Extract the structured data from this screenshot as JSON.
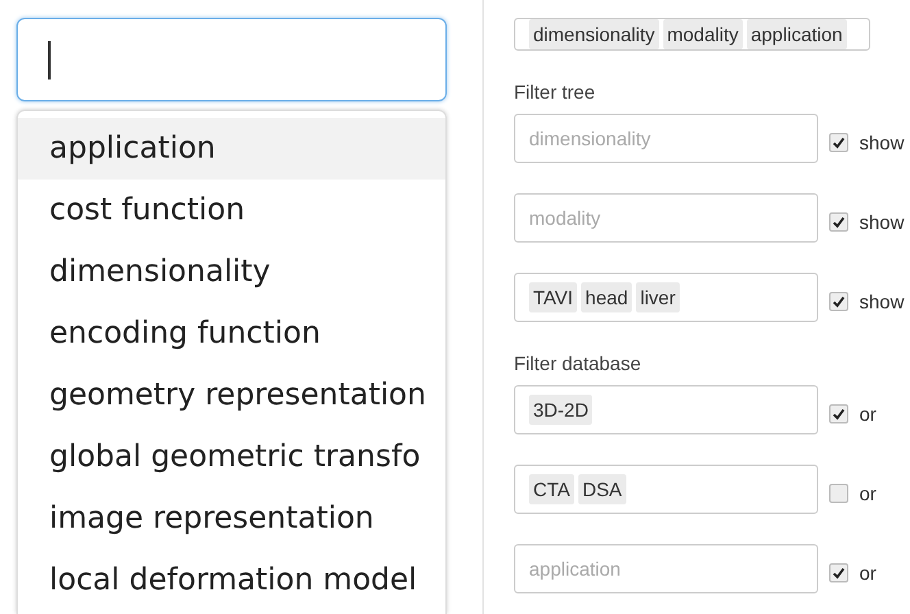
{
  "search": {
    "focused": true
  },
  "suggestions": [
    {
      "label": "application",
      "selected": true
    },
    {
      "label": "cost function",
      "selected": false
    },
    {
      "label": "dimensionality",
      "selected": false
    },
    {
      "label": "encoding function",
      "selected": false
    },
    {
      "label": "geometry representation",
      "selected": false
    },
    {
      "label": "global geometric transfo",
      "selected": false
    },
    {
      "label": "image representation",
      "selected": false
    },
    {
      "label": "local deformation model",
      "selected": false
    }
  ],
  "columns_field": {
    "tags": [
      "dimensionality",
      "modality",
      "application"
    ]
  },
  "filter_tree": {
    "title": "Filter tree",
    "filters": [
      {
        "placeholder": "dimensionality",
        "checked": true,
        "option": "show"
      },
      {
        "placeholder": "modality",
        "checked": true,
        "option": "show"
      },
      {
        "tags": [
          "TAVI",
          "head",
          "liver"
        ],
        "checked": true,
        "option": "show"
      }
    ]
  },
  "filter_database": {
    "title": "Filter database",
    "filters": [
      {
        "tags": [
          "3D-2D"
        ],
        "checked": true,
        "option": "or"
      },
      {
        "tags": [
          "CTA",
          "DSA"
        ],
        "checked": false,
        "option": "or"
      },
      {
        "placeholder": "application",
        "checked": true,
        "option": "or"
      }
    ]
  }
}
